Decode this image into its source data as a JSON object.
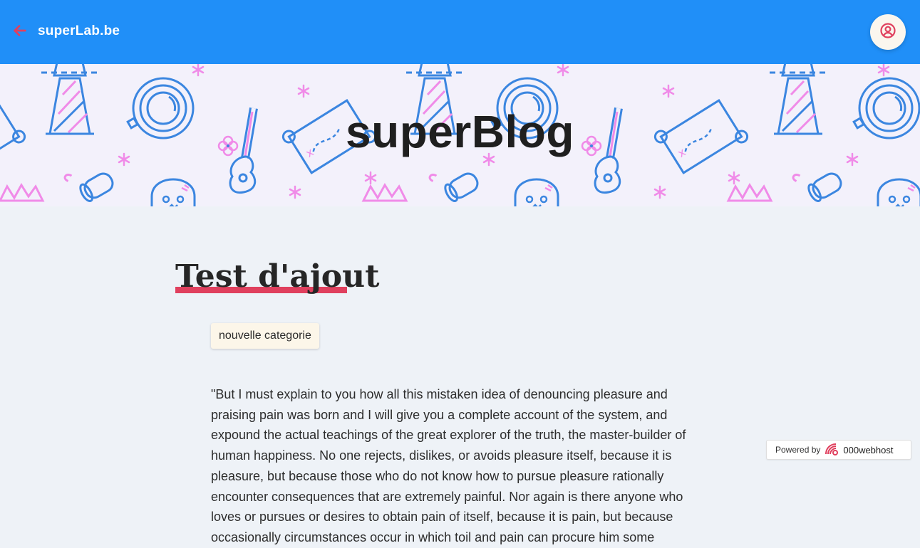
{
  "header": {
    "back_icon": "arrow-left-icon",
    "brand": "superLab.be",
    "user_icon": "user-circle-icon",
    "colors": {
      "bar": "#208ff8",
      "accent": "#e0405e"
    }
  },
  "hero": {
    "title": "superBlog"
  },
  "post": {
    "title": "Test d'ajout",
    "category": "nouvelle categorie",
    "body": "\"But I must explain to you how all this mistaken idea of denouncing pleasure and praising pain was born and I will give you a complete account of the system, and expound the actual teachings of the great explorer of the truth, the master-builder of human happiness. No one rejects, dislikes, or avoids pleasure itself, because it is pleasure, but because those who do not know how to pursue pleasure rationally encounter consequences that are extremely painful. Nor again is there anyone who loves or pursues or desires to obtain pain of itself, because it is pain, but because occasionally circumstances occur in which toil and pain can procure him some"
  },
  "powered": {
    "prefix": "Powered by",
    "host": "000webhost"
  }
}
